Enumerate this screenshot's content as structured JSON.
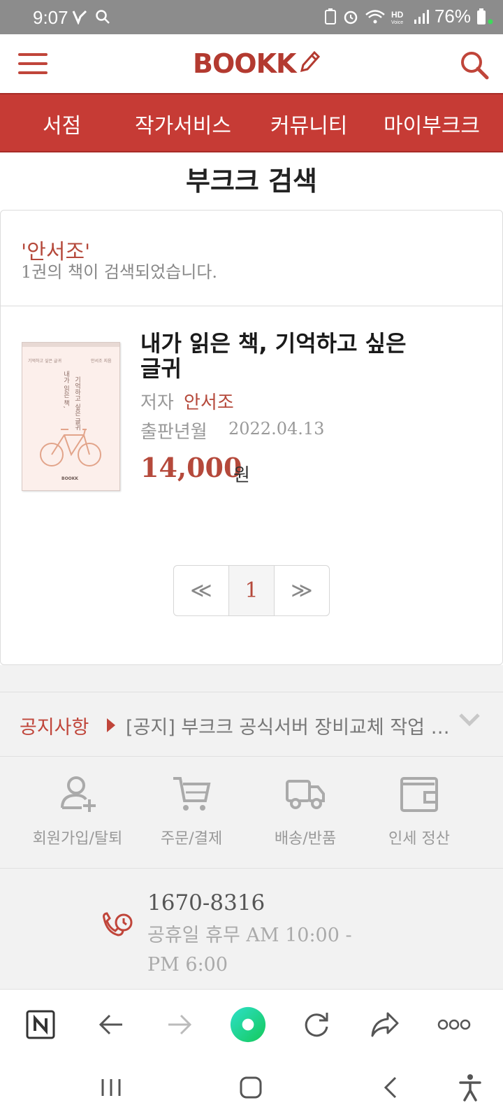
{
  "status_bar": {
    "time": "9:07",
    "battery_percent": "76%",
    "icons": [
      "vpn-icon",
      "search-icon",
      "battery-saver-icon",
      "alarm-icon",
      "wifi-icon",
      "hd-voice-icon",
      "signal-icon",
      "battery-icon"
    ]
  },
  "header": {
    "logo_text": "BOOKK",
    "menu_icon": "hamburger-menu-icon",
    "search_icon": "search-icon"
  },
  "nav": {
    "items": [
      {
        "label": "서점"
      },
      {
        "label": "작가서비스"
      },
      {
        "label": "커뮤니티"
      },
      {
        "label": "마이부크크"
      }
    ]
  },
  "page_title": "부크크 검색",
  "search": {
    "query": "'안서조'",
    "count_text": "1권의 책이 검색되었습니다."
  },
  "results": [
    {
      "title": "내가 읽은 책, 기억하고 싶은 글귀",
      "author_label": "저자",
      "author": "안서조",
      "pubdate_label": "출판년월",
      "pubdate": "2022.04.13",
      "price": "14,000",
      "currency": "원",
      "cover": {
        "subtitle_left": "기억하고 싶은 글귀",
        "author_small": "안서조 지음",
        "vertical_title_1": "내가 읽은 책,",
        "vertical_title_2": "기억하고 싶은 글귀",
        "publisher": "BOOKK"
      }
    }
  ],
  "pagination": {
    "prev": "≪",
    "current": "1",
    "next": "≫"
  },
  "notice": {
    "label": "공지사항",
    "text": "[공지] 부크크 공식서버 장비교체 작업 안내"
  },
  "services": [
    {
      "label": "회원가입/탈퇴",
      "icon": "user-add-icon"
    },
    {
      "label": "주문/결제",
      "icon": "cart-icon"
    },
    {
      "label": "배송/반품",
      "icon": "truck-icon"
    },
    {
      "label": "인세 정산",
      "icon": "wallet-icon"
    }
  ],
  "contact": {
    "phone": "1670-8316",
    "hours": "공휴일 휴무 AM 10:00 - PM 6:00"
  },
  "browser_bar": {
    "items": [
      "naver-icon",
      "back-icon",
      "forward-icon",
      "home-orb-icon",
      "refresh-icon",
      "share-icon",
      "more-icon"
    ]
  },
  "system_nav": {
    "items": [
      "recents-icon",
      "home-icon",
      "back-icon",
      "accessibility-icon"
    ]
  },
  "colors": {
    "brand": "#c63b35",
    "accent_text": "#b5493b",
    "status_bar": "#8c8c8c"
  }
}
